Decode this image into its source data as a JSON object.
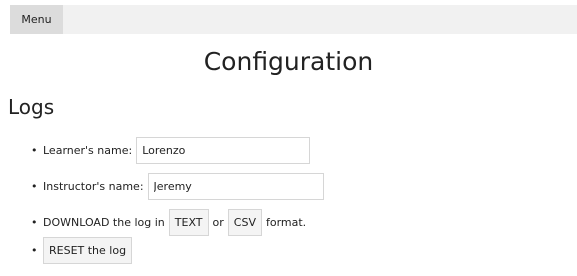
{
  "menu": {
    "label": "Menu"
  },
  "page_title": "Configuration",
  "logs": {
    "title": "Logs",
    "bullet": "•",
    "learner_label": "Learner's name:",
    "learner_value": "Lorenzo",
    "instructor_label": "Instructor's name:",
    "instructor_value": "Jeremy",
    "download_prefix": "DOWNLOAD the log in",
    "text_button": "TEXT",
    "or_text": "or",
    "csv_button": "CSV",
    "format_suffix": "format.",
    "reset_button": "RESET the log"
  }
}
